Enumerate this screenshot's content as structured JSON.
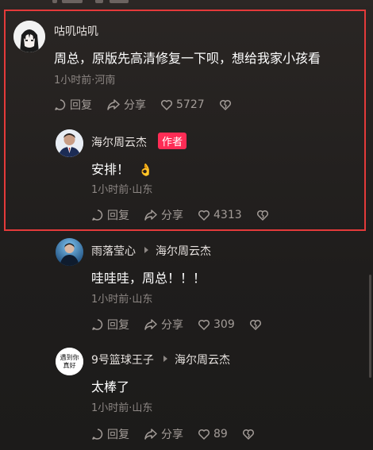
{
  "comments": [
    {
      "user": "咕叽咕叽",
      "text": "周总，原版先高清修复一下呗，想给我家小孩看",
      "meta": "1小时前·河南",
      "reply": "回复",
      "share": "分享",
      "likes": "5727"
    },
    {
      "user": "海尔周云杰",
      "badge": "作者",
      "text": "安排！",
      "emoji": "👌",
      "meta": "1小时前·山东",
      "reply": "回复",
      "share": "分享",
      "likes": "4313"
    },
    {
      "user": "雨落莹心",
      "reply_to": "海尔周云杰",
      "text": "哇哇哇，周总！！！",
      "meta": "1小时前·山东",
      "reply": "回复",
      "share": "分享",
      "likes": "309"
    },
    {
      "user": "9号篮球王子",
      "reply_to": "海尔周云杰",
      "text": "太棒了",
      "meta": "1小时前·山东",
      "reply": "回复",
      "share": "分享",
      "likes": "89",
      "avatar_text": "遇到你真好"
    }
  ],
  "colors": {
    "highlight_border": "#e43a3a",
    "author_badge": "#fe2c55"
  }
}
